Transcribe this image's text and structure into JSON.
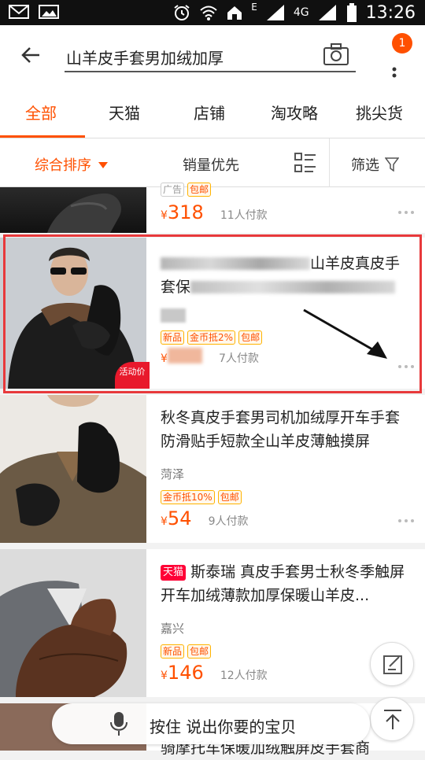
{
  "status_bar": {
    "time": "13:26",
    "network": "4G",
    "signal_e": "E"
  },
  "search": {
    "query": "山羊皮手套男加绒加厚",
    "notification_count": "1"
  },
  "tabs": [
    {
      "label": "全部"
    },
    {
      "label": "天猫"
    },
    {
      "label": "店铺"
    },
    {
      "label": "淘攻略"
    },
    {
      "label": "挑尖货"
    }
  ],
  "sort": {
    "default_label": "综合排序",
    "sales_label": "销量优先",
    "filter_label": "筛选"
  },
  "items": [
    {
      "ad_tag": "广告",
      "tags": [
        "包邮"
      ],
      "price": "318",
      "yen": "¥",
      "sold": "11人付款"
    },
    {
      "title": "秋冬真皮手套男司机加绒厚开车手套防滑贴手短款全山羊皮薄触摸屏",
      "location": "菏泽",
      "tags": [
        "金币抵10%",
        "包邮"
      ],
      "price": "54",
      "yen": "¥",
      "sold": "9人付款"
    },
    {
      "brand_tag": "天猫",
      "title": "斯泰瑞 真皮手套男士秋冬季触屏开车加绒薄款加厚保暖山羊皮...",
      "location": "嘉兴",
      "tags": [
        "新品",
        "包邮"
      ],
      "price": "146",
      "yen": "¥",
      "sold": "12人付款"
    },
    {
      "title": "骑摩托车保暖加绒触屏皮手套商"
    }
  ],
  "highlighted_item": {
    "title_tail": "山羊皮真皮手",
    "title_line2_head": "套保",
    "tags": [
      "新品",
      "金币抵2%",
      "包邮"
    ],
    "yen": "¥",
    "sold": "7人付款",
    "promo": "活动价"
  },
  "voice": {
    "label": "按住 说出你要的宝贝"
  },
  "colors": {
    "accent": "#ff5000",
    "highlight_border": "#e8393b",
    "tmall": "#ff0036"
  }
}
